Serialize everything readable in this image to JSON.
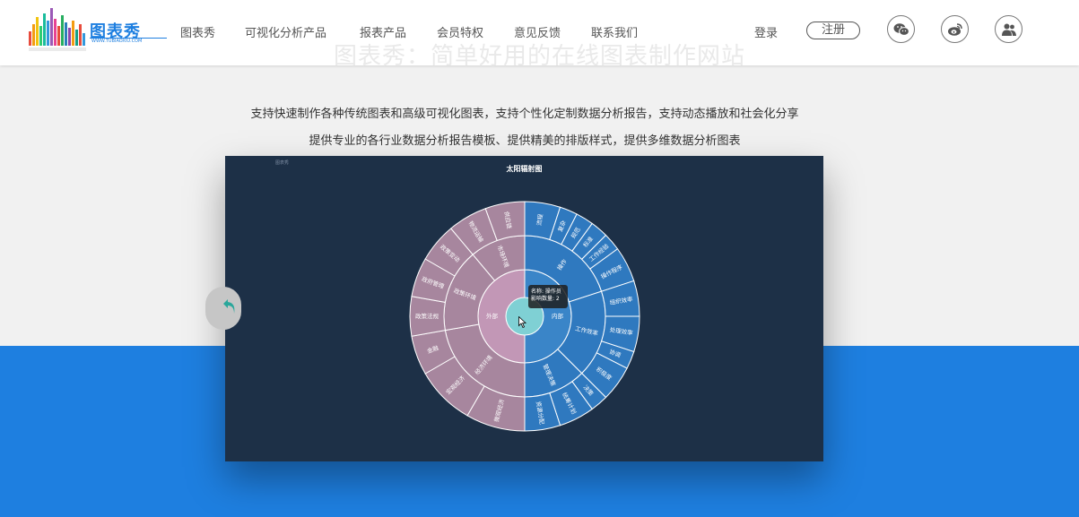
{
  "nav": {
    "logo_text": "图表秀",
    "logo_sub": "WWW.TUBIAOXIU.COM",
    "items": [
      "图表秀",
      "可视化分析产品",
      "报表产品",
      "会员特权",
      "意见反馈",
      "联系我们"
    ],
    "login": "登录",
    "register": "注册",
    "social": [
      "wechat-icon",
      "weibo-icon",
      "group-icon"
    ]
  },
  "hero": {
    "faded_title": "图表秀：简单好用的在线图表制作网站",
    "desc_1": "支持快速制作各种传统图表和高级可视化图表，支持个性化定制数据分析报告，支持动态播放和社会化分享",
    "desc_2": "提供专业的各行业数据分析报告模板、提供精美的排版样式，提供多维数据分析图表"
  },
  "chart_data": {
    "type": "sunburst",
    "title": "太阳辐射图",
    "watermark": "图表秀",
    "center": "",
    "inner": [
      {
        "name": "外部",
        "children": [
          {
            "name": "经济环境",
            "children": [
              {
                "name": "微观经济",
                "value": 3
              },
              {
                "name": "宏观经济",
                "value": 3
              },
              {
                "name": "金融",
                "value": 2
              }
            ]
          },
          {
            "name": "政策环境",
            "children": [
              {
                "name": "政策法规",
                "value": 2
              },
              {
                "name": "政府管理",
                "value": 2
              },
              {
                "name": "政策变动",
                "value": 2
              }
            ]
          },
          {
            "name": "市场环境",
            "children": [
              {
                "name": "物流运输",
                "value": 2
              },
              {
                "name": "供应链",
                "value": 2
              }
            ]
          }
        ]
      },
      {
        "name": "内部",
        "children": [
          {
            "name": "操作",
            "children": [
              {
                "name": "流程",
                "value": 2
              },
              {
                "name": "复杂",
                "value": 1
              },
              {
                "name": "规范",
                "value": 1
              },
              {
                "name": "标准",
                "value": 1
              },
              {
                "name": "工作经验",
                "value": 1
              },
              {
                "name": "操作程序",
                "value": 2
              }
            ]
          },
          {
            "name": "工作效率",
            "children": [
              {
                "name": "组织效率",
                "value": 2
              },
              {
                "name": "处理效率",
                "value": 2
              },
              {
                "name": "协调",
                "value": 1
              },
              {
                "name": "积极度",
                "value": 2
              }
            ]
          },
          {
            "name": "管理决策",
            "children": [
              {
                "name": "决策",
                "value": 1
              },
              {
                "name": "统筹计划",
                "value": 2
              },
              {
                "name": "资源分配",
                "value": 2
              }
            ]
          }
        ]
      }
    ],
    "tooltip": {
      "line1": "名称: 操作员",
      "line2": "影响数量: 2"
    },
    "colors": {
      "outer_side": "#a7869e",
      "outer_mid": "#c297b6",
      "inner_side": "#3a85c8",
      "inner_mid": "#2f79bf",
      "center": "#7fd0d4",
      "background": "#1d3047"
    }
  }
}
